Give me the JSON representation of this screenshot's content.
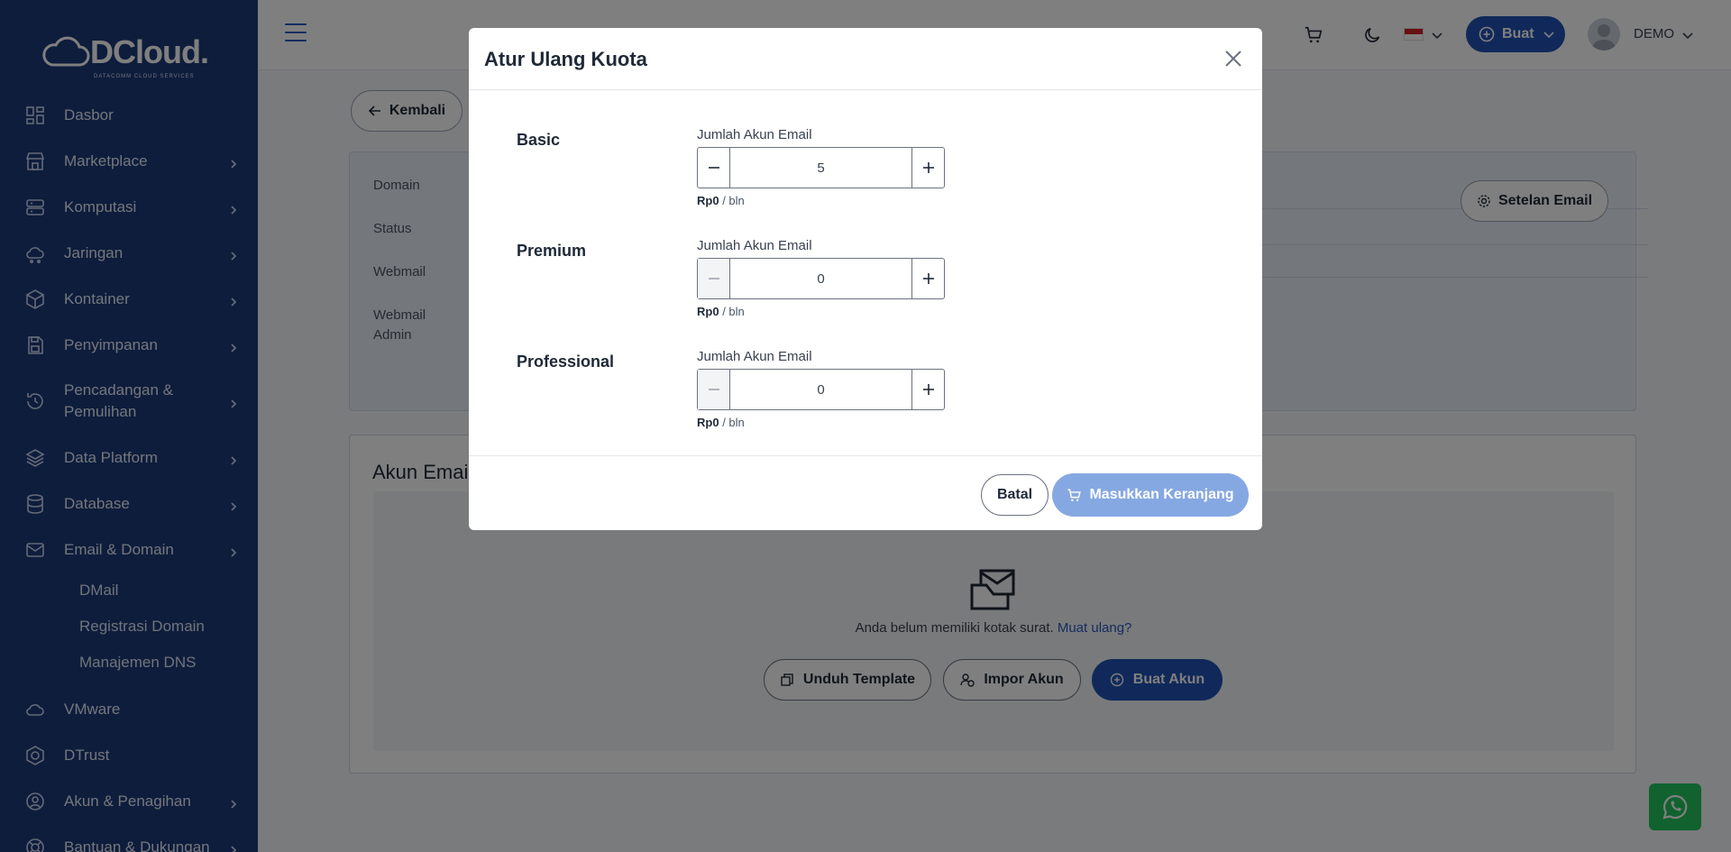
{
  "brand": {
    "name": "DCloud.",
    "tagline": "DATACOMM CLOUD SERVICES"
  },
  "sidebar": {
    "items": [
      {
        "label": "Dasbor",
        "icon": "dashboard-icon",
        "chevron": false
      },
      {
        "label": "Marketplace",
        "icon": "store-icon",
        "chevron": true
      },
      {
        "label": "Komputasi",
        "icon": "server-icon",
        "chevron": true
      },
      {
        "label": "Jaringan",
        "icon": "cloud-network-icon",
        "chevron": true
      },
      {
        "label": "Kontainer",
        "icon": "box-icon",
        "chevron": true
      },
      {
        "label": "Penyimpanan",
        "icon": "storage-icon",
        "chevron": true
      },
      {
        "label": "Pencadangan & Pemulihan",
        "icon": "backup-icon",
        "chevron": true
      },
      {
        "label": "Data Platform",
        "icon": "layers-icon",
        "chevron": true
      },
      {
        "label": "Database",
        "icon": "database-icon",
        "chevron": true
      },
      {
        "label": "Email & Domain",
        "icon": "mail-icon",
        "chevron": true
      }
    ],
    "sub_items": [
      "DMail",
      "Registrasi Domain",
      "Manajemen DNS"
    ],
    "items_after": [
      {
        "label": "VMware",
        "icon": "cloud-icon",
        "chevron": false
      },
      {
        "label": "DTrust",
        "icon": "shield-icon",
        "chevron": false
      },
      {
        "label": "Akun & Penagihan",
        "icon": "user-circle-icon",
        "chevron": true
      },
      {
        "label": "Bantuan & Dukungan",
        "icon": "lifebuoy-icon",
        "chevron": true
      }
    ]
  },
  "topbar": {
    "create_label": "Buat",
    "user_label": "DEMO"
  },
  "main": {
    "back_label": "Kembali",
    "info_labels": [
      "Domain",
      "Status",
      "Webmail",
      "Webmail Admin"
    ],
    "email_settings_label": "Setelan Email",
    "accounts_title": "Akun Email",
    "empty_text": "Anda belum memiliki kotak surat.",
    "reload_link": "Muat ulang?",
    "download_template_label": "Unduh Template",
    "import_label": "Impor Akun",
    "create_account_label": "Buat Akun"
  },
  "modal": {
    "title": "Atur Ulang Kuota",
    "tiers": [
      {
        "name": "Basic",
        "field_label": "Jumlah Akun Email",
        "value": "5",
        "price": "Rp0",
        "period": "/ bln",
        "minus_disabled": false
      },
      {
        "name": "Premium",
        "field_label": "Jumlah Akun Email",
        "value": "0",
        "price": "Rp0",
        "period": "/ bln",
        "minus_disabled": true
      },
      {
        "name": "Professional",
        "field_label": "Jumlah Akun Email",
        "value": "0",
        "price": "Rp0",
        "period": "/ bln",
        "minus_disabled": true
      }
    ],
    "cancel_label": "Batal",
    "add_to_cart_label": "Masukkan Keranjang"
  },
  "colors": {
    "sidebar": "#1d3a78",
    "primary": "#2152b5",
    "primary_disabled": "#86a8e2",
    "whatsapp": "#22c55e"
  }
}
